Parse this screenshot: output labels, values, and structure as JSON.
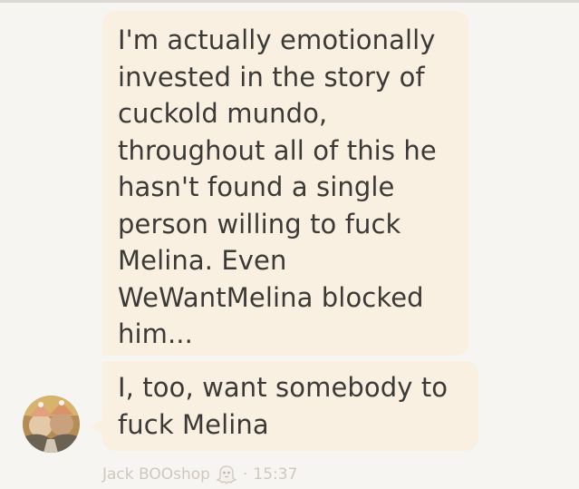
{
  "messages": [
    {
      "text": "I'm actually emotionally\ninvested in the story of\ncuckold mundo,\nthroughout all of this he\nhasn't found a single\nperson willing to fuck\nMelina. Even\nWeWantMelina blocked\nhim..."
    },
    {
      "text": "I, too, want somebody to\nfuck Melina"
    }
  ],
  "sender": {
    "name": "Jack BOOshop",
    "badge_icon": "ghost-icon",
    "separator": "·",
    "time": "15:37"
  },
  "colors": {
    "background": "#f7f5f2",
    "bubble": "#f9f0e2",
    "message_text": "#3c3a37",
    "meta_text": "#cfc8bd"
  }
}
